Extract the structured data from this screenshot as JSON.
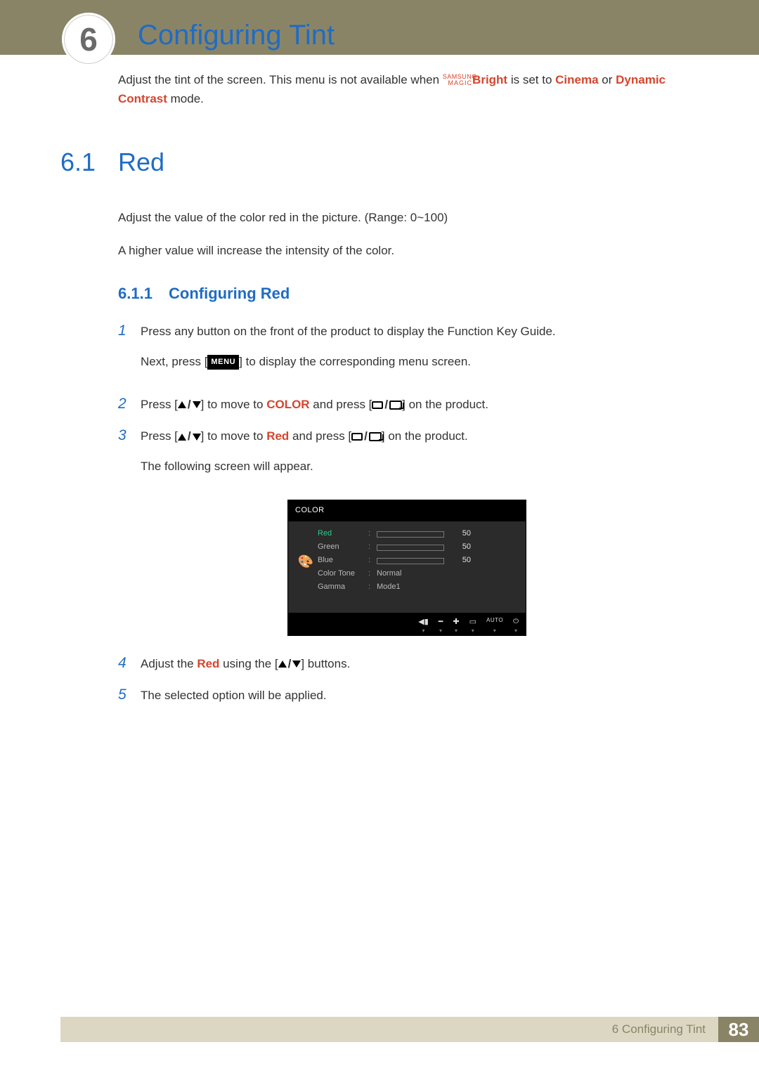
{
  "chapter": {
    "number": "6",
    "title": "Configuring Tint"
  },
  "intro": {
    "prefix": "Adjust the tint of the screen. This menu is not available when ",
    "samsung_sup": "SAMSUNG",
    "samsung_sub": "MAGIC",
    "bright": "Bright",
    "mid": " is set to ",
    "cinema": "Cinema",
    "or": " or ",
    "dyncon": "Dynamic Contrast",
    "suffix": " mode."
  },
  "section": {
    "num": "6.1",
    "title": "Red",
    "p1": "Adjust the value of the color red in the picture. (Range: 0~100)",
    "p2": "A higher value will increase the intensity of the color."
  },
  "subsection": {
    "num": "6.1.1",
    "title": "Configuring Red"
  },
  "steps": {
    "s1a": "Press any button on the front of the product to display the Function Key Guide.",
    "s1b_pre": "Next, press [",
    "s1b_menu": "MENU",
    "s1b_post": "] to display the corresponding menu screen.",
    "s2_pre": "Press [",
    "s2_mid1": "] to move to ",
    "s2_color": "COLOR",
    "s2_mid2": " and press [",
    "s2_post": "] on the product.",
    "s3_pre": "Press [",
    "s3_mid1": "] to move to ",
    "s3_red": "Red",
    "s3_mid2": " and press [",
    "s3_post": "] on the product.",
    "s3_follow": "The following screen will appear.",
    "s4_pre": "Adjust the ",
    "s4_red": "Red",
    "s4_mid": " using the [",
    "s4_post": "] buttons.",
    "s5": "The selected option will be applied."
  },
  "osd": {
    "title": "COLOR",
    "rows": {
      "red": {
        "label": "Red",
        "value": "50"
      },
      "green": {
        "label": "Green",
        "value": "50"
      },
      "blue": {
        "label": "Blue",
        "value": "50"
      },
      "tone": {
        "label": "Color Tone",
        "text": "Normal"
      },
      "gamma": {
        "label": "Gamma",
        "text": "Mode1"
      }
    },
    "footer": {
      "auto": "AUTO"
    }
  },
  "footer": {
    "chapter_label": "6 Configuring Tint",
    "page": "83"
  }
}
